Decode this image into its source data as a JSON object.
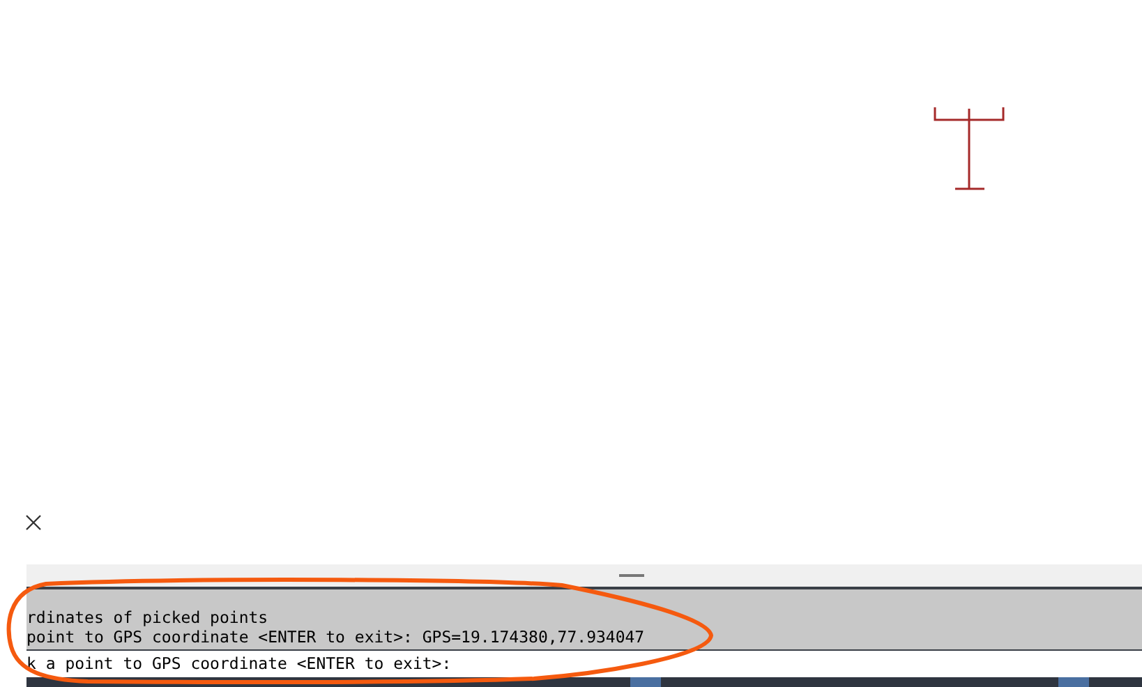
{
  "command_line": {
    "history": [
      "rdinates of picked points",
      "point to GPS coordinate <ENTER to exit>: GPS=19.174380,77.934047"
    ],
    "prompt": "k a point to GPS coordinate <ENTER to exit>:"
  }
}
